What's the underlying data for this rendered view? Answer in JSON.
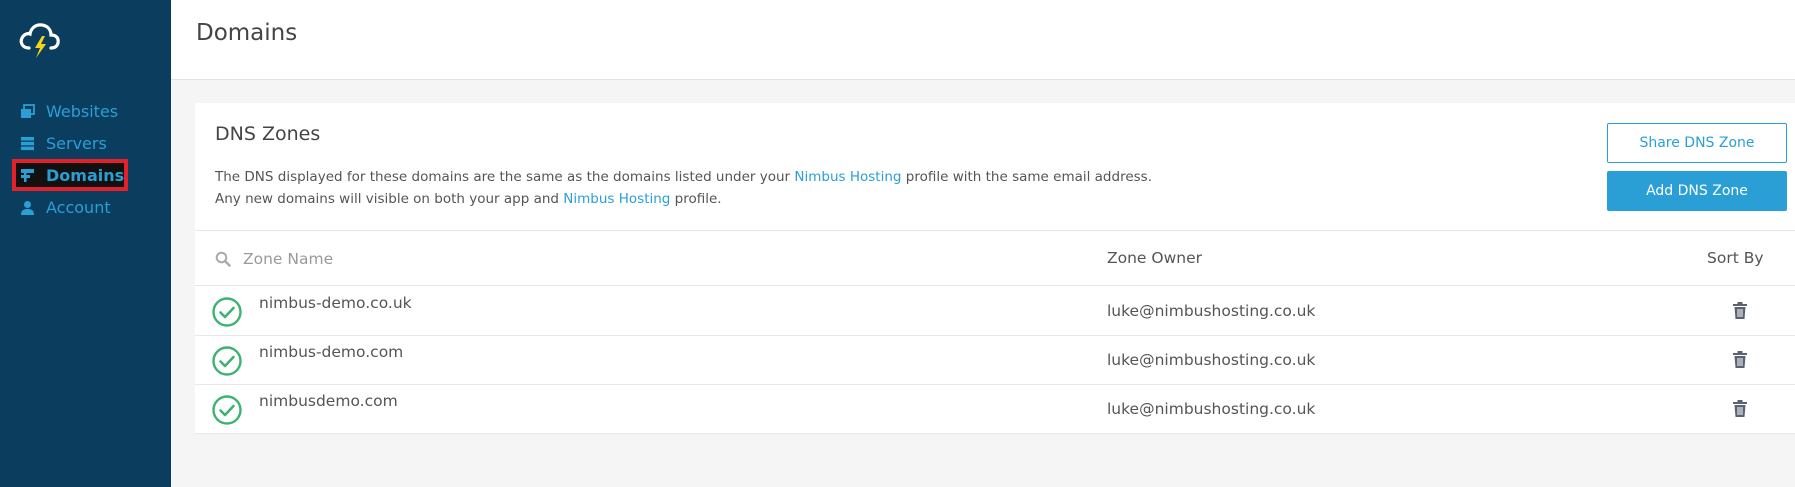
{
  "sidebar": {
    "logo": "cloud-lightning-logo",
    "items": [
      {
        "label": "Websites",
        "icon": "websites-icon"
      },
      {
        "label": "Servers",
        "icon": "servers-icon"
      },
      {
        "label": "Domains",
        "icon": "domains-icon",
        "active": true
      },
      {
        "label": "Account",
        "icon": "account-icon"
      }
    ]
  },
  "header": {
    "title": "Domains"
  },
  "card": {
    "title": "DNS Zones",
    "desc_line1_a": "The DNS displayed for these domains are the same as the domains listed under your ",
    "desc_line1_link": "Nimbus Hosting",
    "desc_line1_b": " profile with the same email address.",
    "desc_line2_a": "Any new domains will visible on both your app and ",
    "desc_line2_link": "Nimbus Hosting",
    "desc_line2_b": " profile.",
    "share_button": "Share DNS Zone",
    "add_button": "Add DNS Zone"
  },
  "table": {
    "search_placeholder": "Zone Name",
    "owner_header": "Zone Owner",
    "sort_header": "Sort By",
    "rows": [
      {
        "name": "nimbus-demo.co.uk",
        "owner": "luke@nimbushosting.co.uk",
        "status": "verified"
      },
      {
        "name": "nimbus-demo.com",
        "owner": "luke@nimbushosting.co.uk",
        "status": "verified"
      },
      {
        "name": "nimbusdemo.com",
        "owner": "luke@nimbushosting.co.uk",
        "status": "verified"
      }
    ]
  },
  "colors": {
    "sidebar_bg": "#0b3d5e",
    "accent": "#2a9fd6",
    "success": "#3cb371",
    "highlight": "#e3212b"
  }
}
